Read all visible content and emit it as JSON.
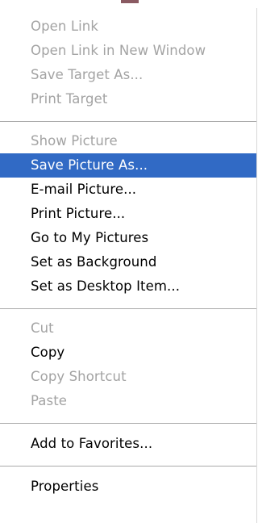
{
  "menu": {
    "groups": [
      {
        "items": [
          {
            "label": "Open Link",
            "enabled": false
          },
          {
            "label": "Open Link in New Window",
            "enabled": false
          },
          {
            "label": "Save Target As...",
            "enabled": false
          },
          {
            "label": "Print Target",
            "enabled": false
          }
        ]
      },
      {
        "items": [
          {
            "label": "Show Picture",
            "enabled": false
          },
          {
            "label": "Save Picture As...",
            "enabled": true,
            "highlighted": true
          },
          {
            "label": "E-mail Picture...",
            "enabled": true
          },
          {
            "label": "Print Picture...",
            "enabled": true
          },
          {
            "label": "Go to My Pictures",
            "enabled": true
          },
          {
            "label": "Set as Background",
            "enabled": true
          },
          {
            "label": "Set as Desktop Item...",
            "enabled": true
          }
        ]
      },
      {
        "items": [
          {
            "label": "Cut",
            "enabled": false
          },
          {
            "label": "Copy",
            "enabled": true
          },
          {
            "label": "Copy Shortcut",
            "enabled": false
          },
          {
            "label": "Paste",
            "enabled": false
          }
        ]
      },
      {
        "items": [
          {
            "label": "Add to Favorites...",
            "enabled": true
          }
        ]
      },
      {
        "items": [
          {
            "label": "Properties",
            "enabled": true
          }
        ]
      }
    ]
  },
  "colors": {
    "highlight_bg": "#316ac5",
    "highlight_text": "#ffffff",
    "disabled_text": "#a3a3a3",
    "enabled_text": "#000000",
    "separator": "#a9a9a9"
  }
}
